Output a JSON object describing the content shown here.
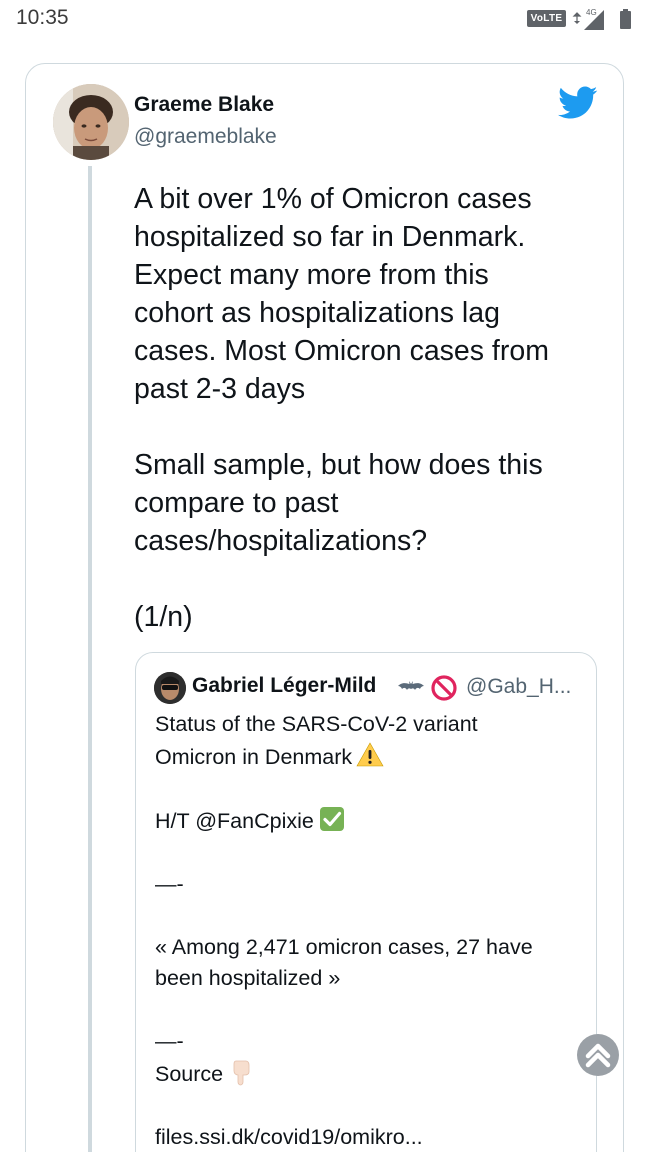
{
  "status_bar": {
    "time": "10:35",
    "volte_label": "VoLTE",
    "network_label": "4G"
  },
  "tweet": {
    "author_name": "Graeme Blake",
    "author_handle": "@graemeblake",
    "body_lines": [
      "A bit over 1% of Omicron cases",
      "hospitalized so far in Denmark.",
      "Expect many more from this",
      "cohort as hospitalizations lag",
      "cases. Most Omicron cases from",
      "past 2-3 days",
      "",
      "Small sample, but how does this",
      "compare to past",
      "cases/hospitalizations?",
      "",
      "(1/n)"
    ]
  },
  "quoted_tweet": {
    "author_name": "Gabriel Léger-Mild",
    "author_handle": "@Gab_H...",
    "line_1": "Status of the SARS-CoV-2 variant",
    "line_2": "Omicron in Denmark",
    "line_3": "H/T @FanCpixie",
    "line_4": "—-",
    "line_5": "« Among 2,471 omicron cases, 27 have",
    "line_6": "been hospitalized »",
    "line_7": "—-",
    "line_8": "Source",
    "line_9": "files.ssi.dk/covid19/omikro..."
  },
  "colors": {
    "twitter_blue": "#1d9bf0",
    "text": "#0f1419",
    "secondary_text": "#536471",
    "border": "#cfd9de"
  },
  "icons": [
    "twitter-bird-icon",
    "bat-icon",
    "no-entry-icon",
    "warning-icon",
    "check-mark-icon",
    "backhand-index-down-icon",
    "scroll-top-icon",
    "signal-icon",
    "battery-icon"
  ]
}
